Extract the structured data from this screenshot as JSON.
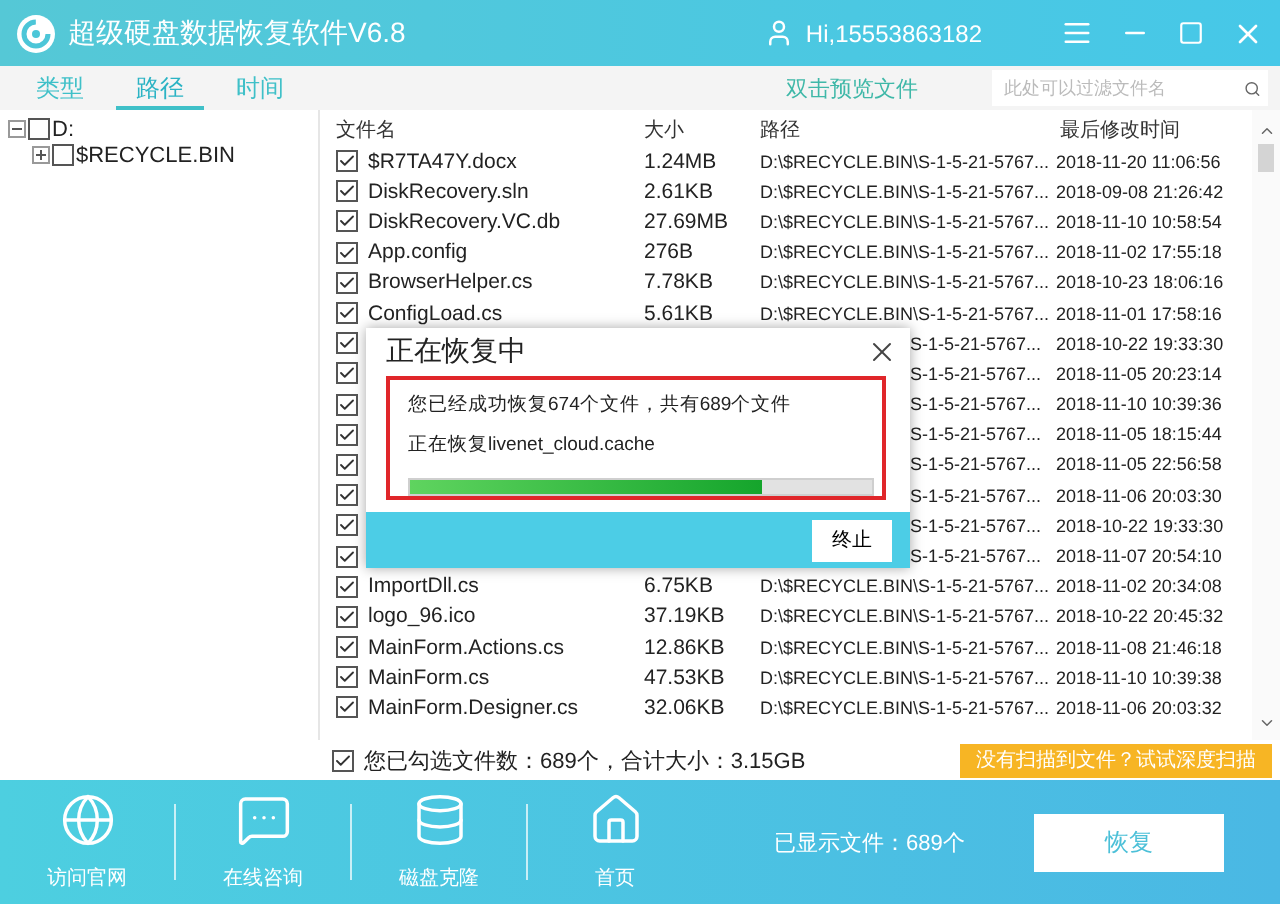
{
  "window": {
    "title": "超级硬盘数据恢复软件V6.8",
    "user": "Hi,15553863182"
  },
  "tabs": [
    {
      "label": "类型",
      "selected": false
    },
    {
      "label": "路径",
      "selected": true
    },
    {
      "label": "时间",
      "selected": false
    }
  ],
  "preview_link": "双击预览文件",
  "search": {
    "placeholder": "此处可以过滤文件名"
  },
  "tree": [
    {
      "label": "D:",
      "checked": false,
      "expanded": true,
      "children": [
        {
          "label": "$RECYCLE.BIN",
          "checked": false,
          "expanded": false
        }
      ]
    }
  ],
  "table": {
    "columns": [
      "文件名",
      "大小",
      "路径",
      "最后修改时间"
    ],
    "rows": [
      {
        "kind": "file",
        "checked": true,
        "name": "$R7TA47Y.docx",
        "size": "1.24MB",
        "path": "D:\\$RECYCLE.BIN\\S-1-5-21-5767...",
        "date": "2018-11-20 11:06:56"
      },
      {
        "kind": "file",
        "checked": true,
        "name": "DiskRecovery.sln",
        "size": "2.61KB",
        "path": "D:\\$RECYCLE.BIN\\S-1-5-21-5767...",
        "date": "2018-09-08 21:26:42"
      },
      {
        "kind": "file",
        "checked": true,
        "name": "DiskRecovery.VC.db",
        "size": "27.69MB",
        "path": "D:\\$RECYCLE.BIN\\S-1-5-21-5767...",
        "date": "2018-11-10 10:58:54"
      },
      {
        "kind": "file",
        "checked": true,
        "name": "App.config",
        "size": "276B",
        "path": "D:\\$RECYCLE.BIN\\S-1-5-21-5767...",
        "date": "2018-11-02 17:55:18"
      },
      {
        "kind": "file",
        "checked": true,
        "name": "BrowserHelper.cs",
        "size": "7.78KB",
        "path": "D:\\$RECYCLE.BIN\\S-1-5-21-5767...",
        "date": "2018-10-23 18:06:16"
      },
      {
        "kind": "file",
        "checked": true,
        "name": "ConfigLoad.cs",
        "size": "5.61KB",
        "path": "D:\\$RECYCLE.BIN\\S-1-5-21-5767...",
        "date": "2018-11-01 17:58:16"
      },
      {
        "kind": "covered",
        "checked": true,
        "path": "S-1-5-21-5767...",
        "date": "2018-10-22 19:33:30"
      },
      {
        "kind": "covered",
        "checked": true,
        "path": "S-1-5-21-5767...",
        "date": "2018-11-05 20:23:14"
      },
      {
        "kind": "covered",
        "checked": true,
        "path": "S-1-5-21-5767...",
        "date": "2018-11-10 10:39:36"
      },
      {
        "kind": "covered",
        "checked": true,
        "path": "S-1-5-21-5767...",
        "date": "2018-11-05 18:15:44"
      },
      {
        "kind": "covered",
        "checked": true,
        "path": "S-1-5-21-5767...",
        "date": "2018-11-05 22:56:58"
      },
      {
        "kind": "covered",
        "checked": true,
        "path": "S-1-5-21-5767...",
        "date": "2018-11-06 20:03:30"
      },
      {
        "kind": "covered",
        "checked": true,
        "path": "S-1-5-21-5767...",
        "date": "2018-10-22 19:33:30"
      },
      {
        "kind": "covered",
        "checked": true,
        "path": "S-1-5-21-5767...",
        "date": "2018-11-07 20:54:10"
      },
      {
        "kind": "file",
        "checked": true,
        "name": "ImportDll.cs",
        "size": "6.75KB",
        "path": "D:\\$RECYCLE.BIN\\S-1-5-21-5767...",
        "date": "2018-11-02 20:34:08"
      },
      {
        "kind": "file",
        "checked": true,
        "name": "logo_96.ico",
        "size": "37.19KB",
        "path": "D:\\$RECYCLE.BIN\\S-1-5-21-5767...",
        "date": "2018-10-22 20:45:32"
      },
      {
        "kind": "file",
        "checked": true,
        "name": "MainForm.Actions.cs",
        "size": "12.86KB",
        "path": "D:\\$RECYCLE.BIN\\S-1-5-21-5767...",
        "date": "2018-11-08 21:46:18"
      },
      {
        "kind": "file",
        "checked": true,
        "name": "MainForm.cs",
        "size": "47.53KB",
        "path": "D:\\$RECYCLE.BIN\\S-1-5-21-5767...",
        "date": "2018-11-10 10:39:38"
      },
      {
        "kind": "file",
        "checked": true,
        "name": "MainForm.Designer.cs",
        "size": "32.06KB",
        "path": "D:\\$RECYCLE.BIN\\S-1-5-21-5767...",
        "date": "2018-11-06 20:03:32"
      }
    ]
  },
  "summary": {
    "checked": true,
    "text": "您已勾选文件数：689个，合计大小：3.15GB"
  },
  "deep_scan_button": "没有扫描到文件？试试深度扫描",
  "footer": {
    "items": [
      {
        "label": "访问官网",
        "kind": "globe"
      },
      {
        "label": "在线咨询",
        "kind": "chat"
      },
      {
        "label": "磁盘克隆",
        "kind": "database"
      },
      {
        "label": "首页",
        "kind": "home"
      }
    ],
    "shown_count": "已显示文件：689个",
    "recover_button": "恢复"
  },
  "dialog": {
    "title": "正在恢复中",
    "message": "您已经成功恢复674个文件，共有689个文件",
    "current": "正在恢复livenet_cloud.cache",
    "level": 0.76,
    "stop_button": "终止"
  }
}
